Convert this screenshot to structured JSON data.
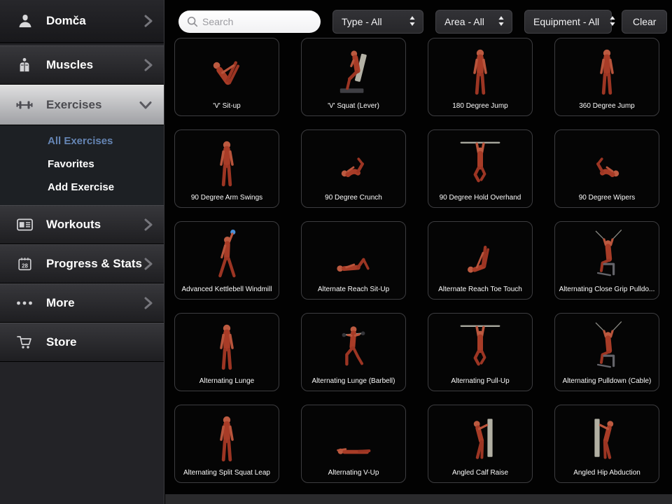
{
  "sidebar": {
    "profile": {
      "name": "Domča"
    },
    "items": [
      {
        "label": "Muscles"
      },
      {
        "label": "Exercises"
      },
      {
        "label": "Workouts"
      },
      {
        "label": "Progress & Stats",
        "icon_day": "28"
      },
      {
        "label": "More"
      },
      {
        "label": "Store"
      }
    ],
    "exercises_submenu": [
      {
        "label": "All Exercises"
      },
      {
        "label": "Favorites"
      },
      {
        "label": "Add Exercise"
      }
    ]
  },
  "filter_bar": {
    "search_placeholder": "Search",
    "dropdowns": [
      {
        "label": "Type - All"
      },
      {
        "label": "Area - All"
      },
      {
        "label": "Equipment - All"
      }
    ],
    "clear_label": "Clear"
  },
  "exercises": [
    {
      "name": "'V' Sit-up",
      "pose": "vsit"
    },
    {
      "name": "'V' Squat (Lever)",
      "pose": "lever"
    },
    {
      "name": "180 Degree Jump",
      "pose": "standing"
    },
    {
      "name": "360 Degree Jump",
      "pose": "standing"
    },
    {
      "name": "90 Degree Arm Swings",
      "pose": "standing"
    },
    {
      "name": "90 Degree Crunch",
      "pose": "crunch"
    },
    {
      "name": "90 Degree Hold Overhand",
      "pose": "hang"
    },
    {
      "name": "90 Degree Wipers",
      "pose": "crunch",
      "flip": true
    },
    {
      "name": "Advanced Kettlebell Windmill",
      "pose": "windmill"
    },
    {
      "name": "Alternate Reach Sit-Up",
      "pose": "lying"
    },
    {
      "name": "Alternate Reach Toe Touch",
      "pose": "legsup"
    },
    {
      "name": "Alternating Close Grip Pulldo...",
      "pose": "pulldown"
    },
    {
      "name": "Alternating Lunge",
      "pose": "standing"
    },
    {
      "name": "Alternating Lunge (Barbell)",
      "pose": "barbell"
    },
    {
      "name": "Alternating Pull-Up",
      "pose": "hang"
    },
    {
      "name": "Alternating Pulldown (Cable)",
      "pose": "pulldown"
    },
    {
      "name": "Alternating Split Squat Leap",
      "pose": "standing"
    },
    {
      "name": "Alternating V-Up",
      "pose": "flat"
    },
    {
      "name": "Angled Calf Raise",
      "pose": "lean"
    },
    {
      "name": "Angled Hip Abduction",
      "pose": "lean",
      "flip": true
    }
  ],
  "colors": {
    "active_link_blue": "#6585b4",
    "selected_row_silver": "#c9c9cc",
    "muscle_red": "#a83c27",
    "kettlebell_blue": "#4a90d9"
  }
}
